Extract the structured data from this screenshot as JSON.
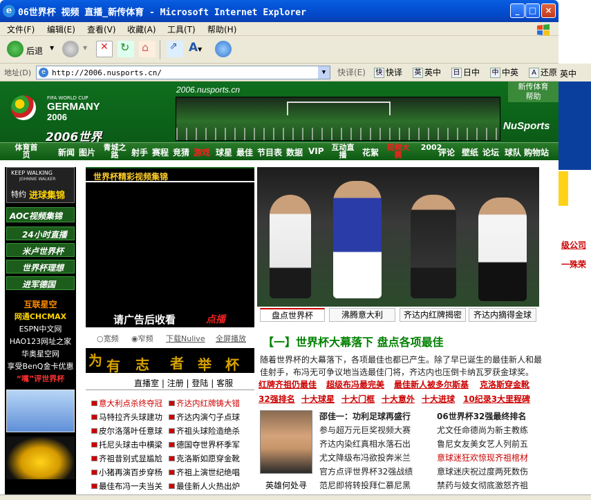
{
  "window": {
    "title": "06世界杯 视频 直播_新传体育 - Microsoft Internet Explorer",
    "minimize": "_",
    "maximize": "□",
    "close": "×"
  },
  "menu": [
    "文件(F)",
    "编辑(E)",
    "查看(V)",
    "收藏(A)",
    "工具(T)",
    "帮助(H)"
  ],
  "toolbar": {
    "back": "后退"
  },
  "address": {
    "label": "地址(D)",
    "url": "http://2006.nusports.cn/",
    "quick_label": "快译(E)",
    "quick": [
      "快译",
      "英中",
      "日中",
      "中英",
      "还原"
    ],
    "quick_icons": [
      "快",
      "英",
      "日",
      "中",
      "A"
    ]
  },
  "outside": {
    "q": "英中",
    "l1": "级公司",
    "l2": "一殊荣"
  },
  "header": {
    "domain": "2006.nusports.cn",
    "wc_line1": "FIFA WORLD CUP",
    "wc_line2": "GERMANY",
    "wc_line3": "2006",
    "wc_cn": "2006世界杯",
    "brand": "NuSports",
    "help1": "新传体育",
    "help2": "帮助"
  },
  "nav": [
    "体育首页",
    "新闻",
    "图片",
    "青城之路",
    "射手",
    "赛程",
    "竞猜",
    "游戏",
    "球星",
    "最佳",
    "节目表",
    "数据",
    "VIP",
    "互动直播",
    "花絮",
    "视频大赛",
    "2002",
    "评论",
    "壁纸",
    "论坛",
    "球队",
    "购物站"
  ],
  "left": {
    "kw1": "KEEP WALKING",
    "kw2": "JOHNNIE WALKER",
    "kw3": "特约",
    "kw4": "进球集锦",
    "aoc": "AOC视频集锦",
    "items": [
      "24小时直播",
      "米卢世界杯",
      "世界杯理想",
      "进军德国"
    ],
    "links": [
      "互联星空",
      "网通CHCMAX",
      "ESPN中文网",
      "HAO123网址之家",
      "华奥星空网",
      "享受BenQ金卡优惠",
      "“嘴”评世界杯"
    ]
  },
  "video": {
    "title": "世界杯精彩视频集锦",
    "ad": "请广告后收看",
    "ad_logo": "点播",
    "radio1": "宽频",
    "radio2": "窄频",
    "download": "下载Nulive",
    "fullscreen": "全屏播放",
    "slogan": [
      "为",
      "有",
      "志",
      "者",
      "举",
      "杯"
    ],
    "links": [
      "直播室",
      "注册",
      "登陆",
      "客服"
    ]
  },
  "news_left": [
    "意大利点杀终夺冠",
    "马特拉齐头球建功",
    "皮尔洛落叶任意球",
    "托尼头球击中横梁",
    "齐祖昔别式显尴尬",
    "小猪再演百步穿杨",
    "最佳布冯一夫当关"
  ],
  "news_right": [
    "齐达内红牌铸大错",
    "齐达内演勺子点球",
    "齐祖头球险造绝杀",
    "德国夺世界杯季军",
    "克洛斯如愿穿金靴",
    "齐祖上演世纪绝唱",
    "最佳新人火热出炉"
  ],
  "tabs": [
    "盘点世界杯",
    "沸腾意大利",
    "齐达内红牌揭密",
    "齐达内摘得金球"
  ],
  "headline": "【一】世界杯大幕落下 盘点各项最佳",
  "intro": "随着世界杯的大幕落下，各项最佳也都已产生。除了早已诞生的最佳新人和最佳射手，布冯无可争议地当选最佳门将，齐达内也压倒卡纳瓦罗获金球奖。",
  "red_row1": [
    "红牌齐祖仍最佳",
    "超级布冯最完美",
    "最佳新人被多尔斯基",
    "克洛斯穿金靴"
  ],
  "red_row2": [
    "32强排名",
    "十大球星",
    "十大门框",
    "十大意外",
    "十大进球",
    "10纪录3大里程碑"
  ],
  "coach_caption": "英雄何处寻",
  "mid_list": [
    "邵佳一：功利足球再盛行",
    "参与超万元巨奖视频大赛",
    "齐达内染红真相水落石出",
    "尤文降级布冯欲投奔米兰",
    "官方点评世界杯32强战绩",
    "范尼即将转投拜仁慕尼黑"
  ],
  "right_list": [
    "06世界杯32强最终排名",
    "尤文任命德尚为新主教练",
    "鲁尼女友美女艺人列前五",
    "意球迷狂欢惊现齐祖棺材",
    "意球迷庆祝过度两死数伤",
    "禁药与妓女彻底激怒齐祖"
  ]
}
